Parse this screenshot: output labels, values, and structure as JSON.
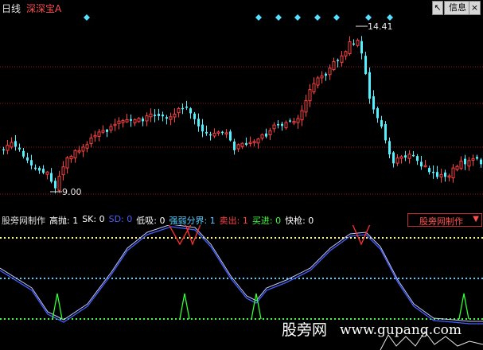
{
  "header": {
    "period": "日线",
    "stock_name": "深深宝A",
    "buttons": {
      "info": "信息"
    }
  },
  "main_chart": {
    "high_label": "14.41",
    "low_label": "9.00",
    "colors": {
      "up": "#ff4040",
      "down": "#54f0ff",
      "grid": "#a01818",
      "diamond": "#54e0ff",
      "label": "#e6e6e6"
    }
  },
  "indicator": {
    "items": [
      {
        "label": "股旁网制作",
        "color": "#e0e0e0"
      },
      {
        "label": "高抛: 1",
        "color": "#ffffff"
      },
      {
        "label": "SK: 0",
        "color": "#ffffff"
      },
      {
        "label": "SD: 0",
        "color": "#5060ff"
      },
      {
        "label": "低吸: 0",
        "color": "#ffffff"
      },
      {
        "label": "强弱分界: 1",
        "color": "#54d0ff"
      },
      {
        "label": "卖出: 1",
        "color": "#ff4040"
      },
      {
        "label": "买进: 0",
        "color": "#40ff40"
      },
      {
        "label": "快枪: 0",
        "color": "#ffffff"
      }
    ],
    "dropdown_label": "股旁网制作",
    "colors": {
      "top_line": "#ffff80",
      "mid_line": "#54d0ff",
      "bottom_line": "#40ff40",
      "curve_blue": "#4060ff",
      "curve_white": "#c8c8ff",
      "sell": "#ff3030",
      "buy": "#30ff30"
    }
  },
  "watermark": {
    "text": "股旁网",
    "url": "www.gupang.com"
  }
}
